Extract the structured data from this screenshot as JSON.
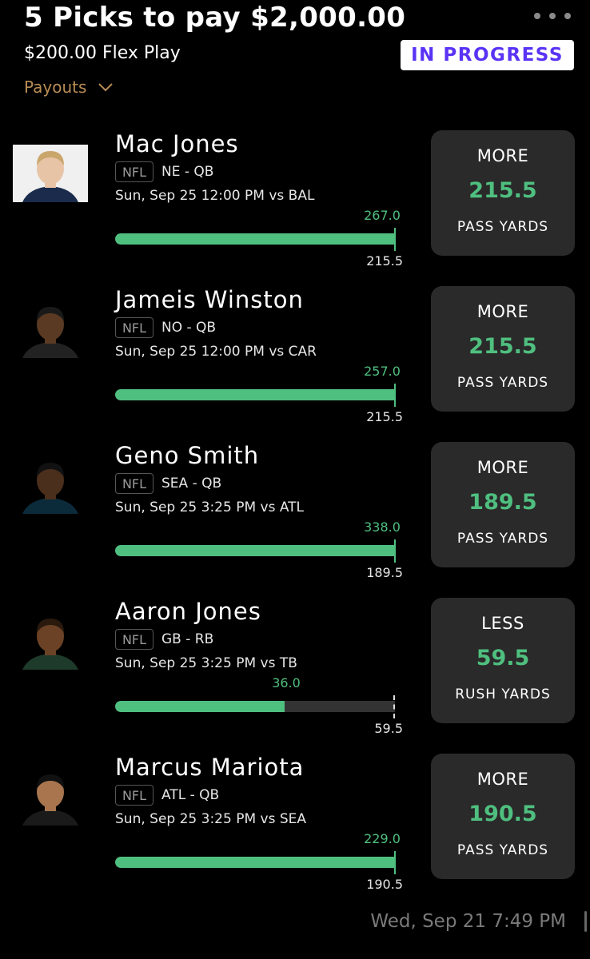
{
  "header": {
    "title": "5 Picks to pay $2,000.00",
    "subtitle": "$200.00 Flex Play",
    "status_badge": "IN PROGRESS",
    "payouts_label": "Payouts",
    "menu_icon": "more-dots-icon",
    "chevron_icon": "chevron-down-icon"
  },
  "colors": {
    "accent_green": "#4fbf7f",
    "badge_text": "#5a33f5",
    "payouts_text": "#b88c55",
    "card_bg": "#2a2a2a"
  },
  "picks": [
    {
      "name": "Mac Jones",
      "league": "NFL",
      "team_pos": "NE - QB",
      "game": "Sun, Sep 25 12:00 PM  vs BAL",
      "current_label": "267.0",
      "target_label": "215.5",
      "progress_fraction": 1.0,
      "direction": "MORE",
      "line": "215.5",
      "stat": "PASS YARDS",
      "skin": "#e8c4a6",
      "hair": "#c9a66b",
      "jersey": "#1a2b4c",
      "light_bg": true
    },
    {
      "name": "Jameis Winston",
      "league": "NFL",
      "team_pos": "NO - QB",
      "game": "Sun, Sep 25 12:00 PM  vs CAR",
      "current_label": "257.0",
      "target_label": "215.5",
      "progress_fraction": 1.0,
      "direction": "MORE",
      "line": "215.5",
      "stat": "PASS YARDS",
      "skin": "#5a3a22",
      "hair": "#1a1a1a",
      "jersey": "#222",
      "light_bg": false
    },
    {
      "name": "Geno Smith",
      "league": "NFL",
      "team_pos": "SEA - QB",
      "game": "Sun, Sep 25 3:25 PM  vs ATL",
      "current_label": "338.0",
      "target_label": "189.5",
      "progress_fraction": 1.0,
      "direction": "MORE",
      "line": "189.5",
      "stat": "PASS YARDS",
      "skin": "#4a2f1c",
      "hair": "#111",
      "jersey": "#0b2a3a",
      "light_bg": false
    },
    {
      "name": "Aaron Jones",
      "league": "NFL",
      "team_pos": "GB - RB",
      "game": "Sun, Sep 25 3:25 PM  vs TB",
      "current_label": "36.0",
      "target_label": "59.5",
      "progress_fraction": 0.605,
      "direction": "LESS",
      "line": "59.5",
      "stat": "RUSH YARDS",
      "skin": "#6b4226",
      "hair": "#2a1a0e",
      "jersey": "#1e3a2a",
      "light_bg": false
    },
    {
      "name": "Marcus Mariota",
      "league": "NFL",
      "team_pos": "ATL - QB",
      "game": "Sun, Sep 25 3:25 PM  vs SEA",
      "current_label": "229.0",
      "target_label": "190.5",
      "progress_fraction": 1.0,
      "direction": "MORE",
      "line": "190.5",
      "stat": "PASS YARDS",
      "skin": "#a8754f",
      "hair": "#111",
      "jersey": "#1a1a1a",
      "light_bg": false
    }
  ],
  "footer": {
    "timestamp": "Wed, Sep 21 7:49 PM"
  }
}
